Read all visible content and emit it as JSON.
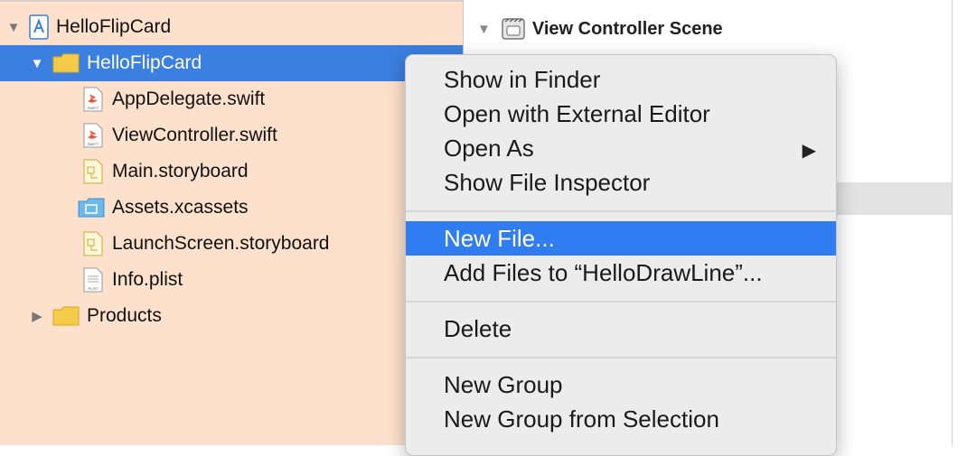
{
  "navigator": {
    "items": [
      {
        "label": "HelloFlipCard",
        "icon": "xcode-project-icon",
        "disclosure": "expanded"
      },
      {
        "label": "HelloFlipCard",
        "icon": "folder-icon",
        "disclosure": "expanded",
        "selected": true
      },
      {
        "label": "AppDelegate.swift",
        "icon": "swift-file-icon"
      },
      {
        "label": "ViewController.swift",
        "icon": "swift-file-icon"
      },
      {
        "label": "Main.storyboard",
        "icon": "storyboard-file-icon"
      },
      {
        "label": "Assets.xcassets",
        "icon": "asset-catalog-icon"
      },
      {
        "label": "LaunchScreen.storyboard",
        "icon": "storyboard-file-icon"
      },
      {
        "label": "Info.plist",
        "icon": "plist-file-icon"
      },
      {
        "label": "Products",
        "icon": "folder-icon",
        "disclosure": "collapsed"
      }
    ],
    "colors": {
      "background": "#fde1cc",
      "selection": "#3b7fe0"
    }
  },
  "outline": {
    "scene_title": "View Controller Scene"
  },
  "context_menu": {
    "items": [
      {
        "label": "Show in Finder"
      },
      {
        "label": "Open with External Editor"
      },
      {
        "label": "Open As",
        "submenu": true
      },
      {
        "label": "Show File Inspector"
      },
      {
        "label": "New File...",
        "highlighted": true
      },
      {
        "label": "Add Files to “HelloDrawLine”..."
      },
      {
        "label": "Delete"
      },
      {
        "label": "New Group"
      },
      {
        "label": "New Group from Selection"
      }
    ],
    "submenu_arrow": "▶",
    "colors": {
      "highlight": "#2f7df0",
      "background": "#ececec"
    }
  }
}
